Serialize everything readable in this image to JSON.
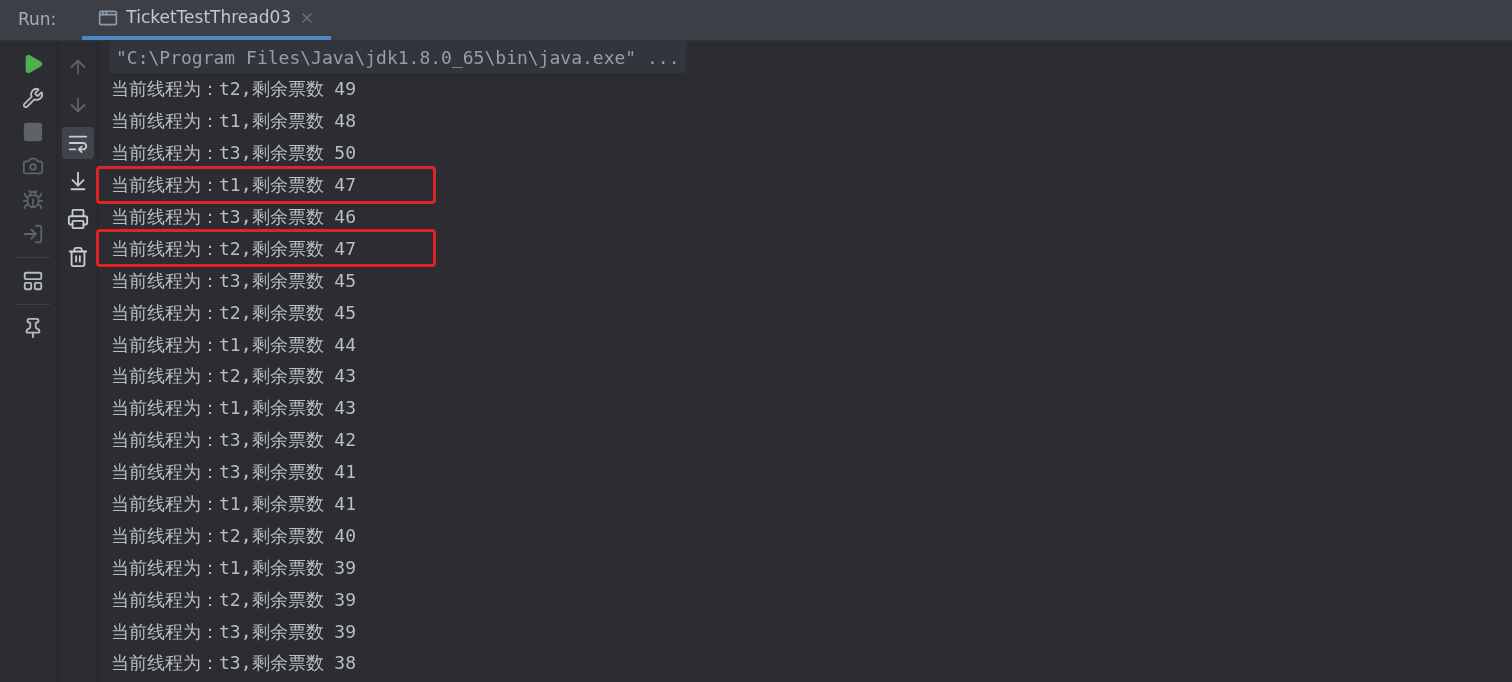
{
  "run_panel": {
    "label": "Run:",
    "tab": {
      "title": "TicketTestThread03",
      "selected": true
    }
  },
  "toolbar_left": [
    {
      "kind": "run",
      "disabled": false
    },
    {
      "kind": "settings",
      "disabled": false
    },
    {
      "kind": "stop",
      "disabled": true
    },
    {
      "kind": "snapshot",
      "disabled": true
    },
    {
      "kind": "debug",
      "disabled": true
    },
    {
      "kind": "exit",
      "disabled": true
    },
    {
      "kind": "layout",
      "disabled": false
    },
    {
      "kind": "pin",
      "disabled": false
    }
  ],
  "toolbar_right": [
    {
      "kind": "up",
      "on": false
    },
    {
      "kind": "down",
      "on": false
    },
    {
      "kind": "wrap",
      "on": true
    },
    {
      "kind": "scroll-end",
      "on": false
    },
    {
      "kind": "print",
      "on": false
    },
    {
      "kind": "clear",
      "on": false
    }
  ],
  "console": {
    "command": "\"C:\\Program Files\\Java\\jdk1.8.0_65\\bin\\java.exe\" ...",
    "lines": [
      {
        "text": "当前线程为：t2,剩余票数 49",
        "highlighted": false
      },
      {
        "text": "当前线程为：t1,剩余票数 48",
        "highlighted": false
      },
      {
        "text": "当前线程为：t3,剩余票数 50",
        "highlighted": false
      },
      {
        "text": "当前线程为：t1,剩余票数 47",
        "highlighted": true
      },
      {
        "text": "当前线程为：t3,剩余票数 46",
        "highlighted": false
      },
      {
        "text": "当前线程为：t2,剩余票数 47",
        "highlighted": true
      },
      {
        "text": "当前线程为：t3,剩余票数 45",
        "highlighted": false
      },
      {
        "text": "当前线程为：t2,剩余票数 45",
        "highlighted": false
      },
      {
        "text": "当前线程为：t1,剩余票数 44",
        "highlighted": false
      },
      {
        "text": "当前线程为：t2,剩余票数 43",
        "highlighted": false
      },
      {
        "text": "当前线程为：t1,剩余票数 43",
        "highlighted": false
      },
      {
        "text": "当前线程为：t3,剩余票数 42",
        "highlighted": false
      },
      {
        "text": "当前线程为：t3,剩余票数 41",
        "highlighted": false
      },
      {
        "text": "当前线程为：t1,剩余票数 41",
        "highlighted": false
      },
      {
        "text": "当前线程为：t2,剩余票数 40",
        "highlighted": false
      },
      {
        "text": "当前线程为：t1,剩余票数 39",
        "highlighted": false
      },
      {
        "text": "当前线程为：t2,剩余票数 39",
        "highlighted": false
      },
      {
        "text": "当前线程为：t3,剩余票数 39",
        "highlighted": false
      },
      {
        "text": "当前线程为：t3,剩余票数 38",
        "highlighted": false
      }
    ]
  }
}
